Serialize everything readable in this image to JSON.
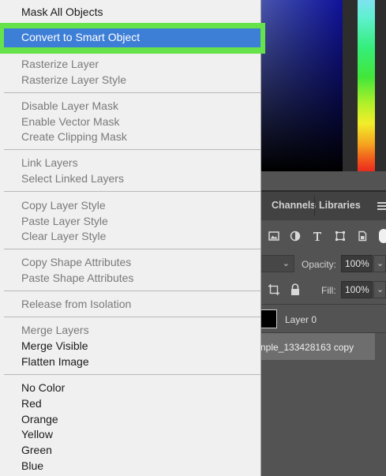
{
  "context_menu": {
    "items": [
      {
        "label": "Mask All Objects",
        "enabled": true
      },
      {
        "label": "Convert to Smart Object",
        "enabled": true,
        "highlighted": true
      },
      {
        "label": "Rasterize Layer",
        "enabled": false
      },
      {
        "label": "Rasterize Layer Style",
        "enabled": false
      },
      {
        "label": "Disable Layer Mask",
        "enabled": false
      },
      {
        "label": "Enable Vector Mask",
        "enabled": false
      },
      {
        "label": "Create Clipping Mask",
        "enabled": false
      },
      {
        "label": "Link Layers",
        "enabled": false
      },
      {
        "label": "Select Linked Layers",
        "enabled": false
      },
      {
        "label": "Copy Layer Style",
        "enabled": false
      },
      {
        "label": "Paste Layer Style",
        "enabled": false
      },
      {
        "label": "Clear Layer Style",
        "enabled": false
      },
      {
        "label": "Copy Shape Attributes",
        "enabled": false
      },
      {
        "label": "Paste Shape Attributes",
        "enabled": false
      },
      {
        "label": "Release from Isolation",
        "enabled": false
      },
      {
        "label": "Merge Layers",
        "enabled": false
      },
      {
        "label": "Merge Visible",
        "enabled": true
      },
      {
        "label": "Flatten Image",
        "enabled": true
      },
      {
        "label": "No Color",
        "enabled": true
      },
      {
        "label": "Red",
        "enabled": true
      },
      {
        "label": "Orange",
        "enabled": true
      },
      {
        "label": "Yellow",
        "enabled": true
      },
      {
        "label": "Green",
        "enabled": true
      },
      {
        "label": "Blue",
        "enabled": true
      }
    ],
    "highlight_color": "#3d7ed6",
    "highlight_outline_color": "#66e34a"
  },
  "layers_panel": {
    "tabs": [
      "Channels",
      "Libraries"
    ],
    "filter_icons": [
      "image-filter-icon",
      "adjustment-filter-icon",
      "type-filter-icon",
      "shape-filter-icon",
      "smart-object-filter-icon"
    ],
    "opacity_label": "Opacity:",
    "opacity_value": "100%",
    "fill_label": "Fill:",
    "fill_value": "100%",
    "layers": [
      {
        "name": "Layer 0"
      },
      {
        "name": "nple_133428163 copy",
        "selected": true
      }
    ]
  }
}
